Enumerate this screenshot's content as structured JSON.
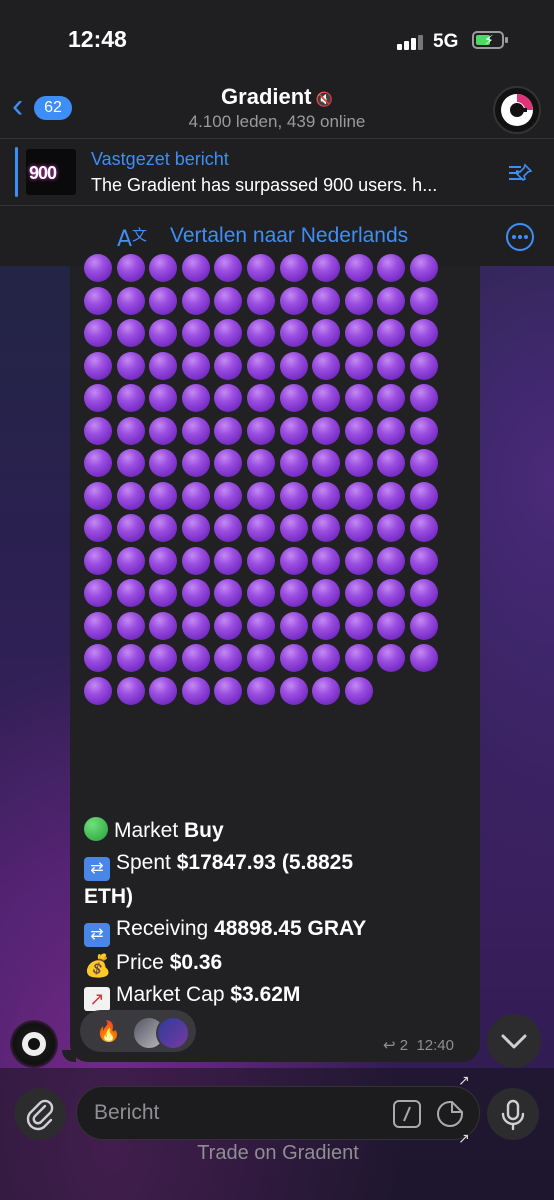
{
  "status": {
    "time": "12:48",
    "network": "5G"
  },
  "header": {
    "back_count": "62",
    "title": "Gradient",
    "subtitle": "4.100 leden, 439 online"
  },
  "pinned": {
    "label": "Vastgezet bericht",
    "text": "The Gradient has surpassed 900 users. h...",
    "thumb_text": "900"
  },
  "translate": {
    "label": "Vertalen naar Nederlands"
  },
  "message": {
    "dot_emoji": "purple-circle",
    "dot_count": 152,
    "lines": [
      {
        "icon": "green-circle",
        "text": "Market ",
        "bold": "Buy"
      },
      {
        "icon": "shuffle",
        "text": "Spent ",
        "bold": "$17847.93 (5.8825"
      },
      {
        "icon": "",
        "text": "",
        "bold": "ETH)"
      },
      {
        "icon": "shuffle",
        "text": "Receiving ",
        "bold": "48898.45 GRAY"
      },
      {
        "icon": "money-bag",
        "text": "Price ",
        "bold": "$0.36"
      },
      {
        "icon": "chart-up",
        "text": "Market Cap ",
        "bold": "$3.62M"
      }
    ],
    "reaction": "🔥",
    "reply_count": "2",
    "time": "12:40"
  },
  "composer": {
    "placeholder": "Bericht",
    "bot_button": "Trade on Gradient"
  },
  "colors": {
    "accent": "#3e8ef7",
    "bubble": "#212123"
  }
}
